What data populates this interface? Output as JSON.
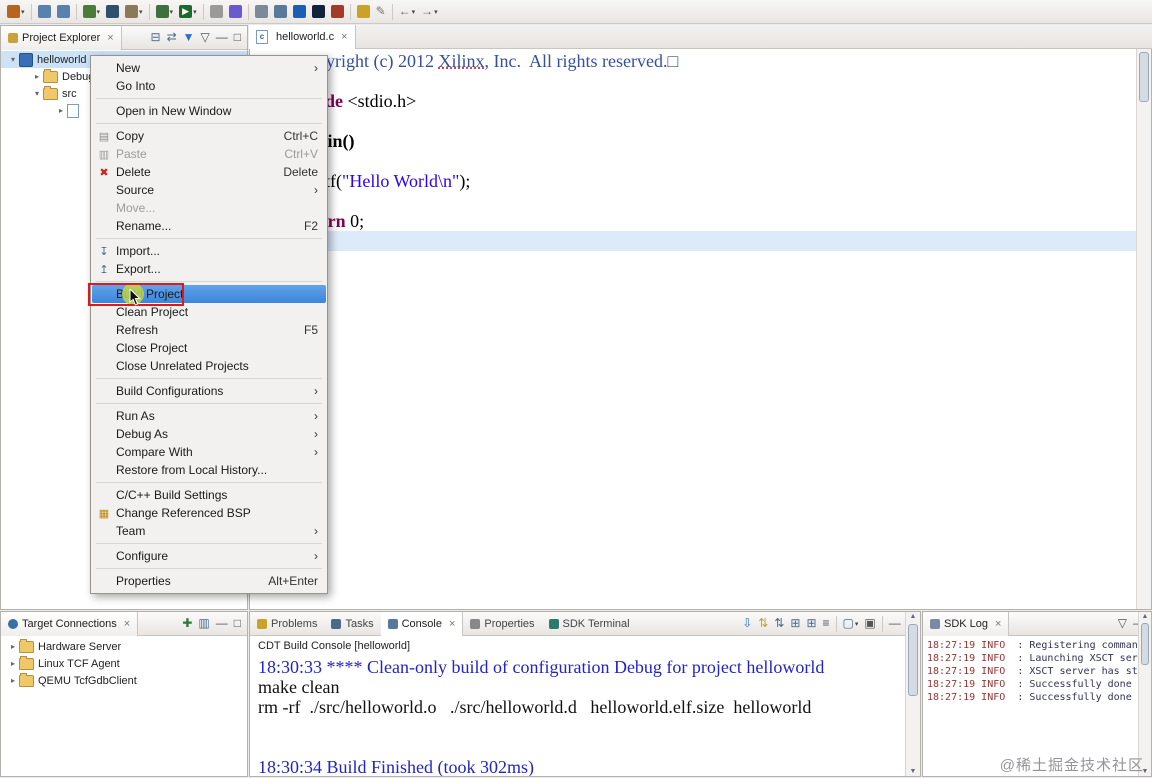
{
  "window": {
    "watermark": "@稀土掘金技术社区"
  },
  "ui": {
    "close_glyph": "×",
    "minimize_glyph": "—",
    "maximize_glyph": "□",
    "caret_glyph": "▾",
    "submenu_arrow": "›",
    "scroll_up_glyph": "▲",
    "scroll_down_glyph": "▼"
  },
  "toolbar": {
    "icons": [
      {
        "name": "new-wizard-icon",
        "color": "#b5651d",
        "caret": true
      },
      {
        "sep": true
      },
      {
        "name": "save-icon",
        "color": "#5a81ad"
      },
      {
        "name": "save-all-icon",
        "color": "#5a81ad"
      },
      {
        "sep": true
      },
      {
        "name": "program-fpga-icon",
        "color": "#4a7d3a",
        "caret": true
      },
      {
        "name": "launch-shell-icon",
        "color": "#2f4f6f"
      },
      {
        "name": "build-icon",
        "color": "#8a7a5a",
        "caret": true
      },
      {
        "sep": true
      },
      {
        "name": "debug-icon",
        "color": "#3f6f3f",
        "caret": true
      },
      {
        "name": "run-icon",
        "color": "#1c6b2a",
        "glyph": "▶",
        "caret": true
      },
      {
        "sep": true
      },
      {
        "name": "cut-icon",
        "color": "#9a9a9a"
      },
      {
        "name": "profile-icon",
        "color": "#6a5acd"
      },
      {
        "sep": true
      },
      {
        "name": "window-layout-icon",
        "color": "#7a8a9a"
      },
      {
        "name": "table-icon",
        "color": "#5a7a9a"
      },
      {
        "name": "vivado-icon",
        "color": "#1a5fb4"
      },
      {
        "name": "xsct-console-icon",
        "color": "#13233b"
      },
      {
        "name": "terminal-icon",
        "color": "#a33a2a"
      },
      {
        "sep": true
      },
      {
        "name": "key-icon",
        "color": "#c9a227"
      },
      {
        "name": "pencil-icon",
        "glyph": "✎",
        "gcolor": "#777777"
      },
      {
        "sep": true
      },
      {
        "name": "back-icon",
        "glyph": "←",
        "gcolor": "#666666",
        "caret": true
      },
      {
        "name": "forward-icon",
        "glyph": "→",
        "gcolor": "#666666",
        "caret": true
      }
    ]
  },
  "project_explorer": {
    "tab_label": "Project Explorer",
    "toolbar_icons": [
      {
        "name": "collapse-all-icon",
        "glyph": "⊟",
        "gcolor": "#4a6b8a"
      },
      {
        "name": "link-with-editor-icon",
        "glyph": "⇄",
        "gcolor": "#4a6b8a"
      },
      {
        "name": "filter-icon",
        "glyph": "▼",
        "gcolor": "#2a6fc9"
      },
      {
        "name": "view-menu-icon",
        "glyph": "▽",
        "gcolor": "#555555"
      },
      {
        "name": "minimize-icon",
        "glyph": "—",
        "gcolor": "#555555"
      },
      {
        "name": "maximize-icon",
        "glyph": "□",
        "gcolor": "#555555"
      }
    ],
    "tree": [
      {
        "label": "helloworld",
        "level": 0,
        "chev": "▾",
        "icon": "project",
        "selected": true
      },
      {
        "label": "Debug",
        "level": 1,
        "chev": "▸",
        "icon": "folder"
      },
      {
        "label": "src",
        "level": 1,
        "chev": "▾",
        "icon": "folder"
      },
      {
        "label": "",
        "level": 2,
        "chev": "▸",
        "icon": "cfile"
      }
    ]
  },
  "editor": {
    "tab_label": "helloworld.c",
    "file_icon_letter": "c",
    "lines": [
      {
        "parts": [
          {
            "t": " * Copyright (c) 2012 ",
            "c": "cmt"
          },
          {
            "t": "Xilinx",
            "c": "cmt ul"
          },
          {
            "t": ", Inc.  All rights reserved.□",
            "c": "cmt"
          }
        ]
      },
      {
        "parts": []
      },
      {
        "parts": [
          {
            "t": "#include",
            "c": "kw"
          },
          {
            "t": " ",
            "c": "plain"
          },
          {
            "t": "<stdio.h>",
            "c": "plain"
          }
        ]
      },
      {
        "parts": []
      },
      {
        "parts": [
          {
            "t": "int",
            "c": "kw"
          },
          {
            "t": " ",
            "c": "plain"
          },
          {
            "t": "main()",
            "c": "fn"
          }
        ]
      },
      {
        "parts": [
          {
            "t": "{",
            "c": "plain"
          }
        ]
      },
      {
        "parts": [
          {
            "t": "    printf(",
            "c": "plain"
          },
          {
            "t": "\"Hello World\\n\"",
            "c": "str"
          },
          {
            "t": ");",
            "c": "plain"
          }
        ]
      },
      {
        "parts": []
      },
      {
        "parts": [
          {
            "t": "    ",
            "c": "plain"
          },
          {
            "t": "return",
            "c": "kw"
          },
          {
            "t": " 0;",
            "c": "plain"
          }
        ]
      },
      {
        "parts": [
          {
            "t": "}",
            "c": "plain"
          }
        ],
        "highlight": true
      }
    ]
  },
  "context_menu": {
    "icon_glyphs": {
      "copy": {
        "g": "▤",
        "c": "#8a8a8a"
      },
      "paste": {
        "g": "▥",
        "c": "#9a9a9a"
      },
      "delete": {
        "g": "✖",
        "c": "#cc2222"
      },
      "import": {
        "g": "↧",
        "c": "#4a6b8a"
      },
      "export": {
        "g": "↥",
        "c": "#4a6b8a"
      },
      "bsp": {
        "g": "▦",
        "c": "#b8860b"
      }
    },
    "items": [
      {
        "label": "New",
        "submenu": true
      },
      {
        "label": "Go Into"
      },
      {
        "sep": true
      },
      {
        "label": "Open in New Window"
      },
      {
        "sep": true
      },
      {
        "label": "Copy",
        "shortcut": "Ctrl+C",
        "icon": "copy"
      },
      {
        "label": "Paste",
        "shortcut": "Ctrl+V",
        "icon": "paste",
        "disabled": true
      },
      {
        "label": "Delete",
        "shortcut": "Delete",
        "icon": "delete"
      },
      {
        "label": "Source",
        "submenu": true
      },
      {
        "label": "Move...",
        "disabled": true
      },
      {
        "label": "Rename...",
        "shortcut": "F2"
      },
      {
        "sep": true
      },
      {
        "label": "Import...",
        "icon": "import"
      },
      {
        "label": "Export...",
        "icon": "export"
      },
      {
        "sep": true
      },
      {
        "label": "Build Project",
        "selected": true
      },
      {
        "label": "Clean Project"
      },
      {
        "label": "Refresh",
        "shortcut": "F5"
      },
      {
        "label": "Close Project"
      },
      {
        "label": "Close Unrelated Projects"
      },
      {
        "sep": true
      },
      {
        "label": "Build Configurations",
        "submenu": true
      },
      {
        "sep": true
      },
      {
        "label": "Run As",
        "submenu": true
      },
      {
        "label": "Debug As",
        "submenu": true
      },
      {
        "label": "Compare With",
        "submenu": true
      },
      {
        "label": "Restore from Local History..."
      },
      {
        "sep": true
      },
      {
        "label": "C/C++ Build Settings"
      },
      {
        "label": "Change Referenced BSP",
        "icon": "bsp"
      },
      {
        "label": "Team",
        "submenu": true
      },
      {
        "sep": true
      },
      {
        "label": "Configure",
        "submenu": true
      },
      {
        "sep": true
      },
      {
        "label": "Properties",
        "shortcut": "Alt+Enter"
      }
    ]
  },
  "target_connections": {
    "tab_label": "Target Connections",
    "toolbar_icons": [
      {
        "name": "new-target-connection-icon",
        "glyph": "✚",
        "gcolor": "#2a7a3a"
      },
      {
        "name": "columns-icon",
        "glyph": "▥",
        "gcolor": "#4a6b8a"
      },
      {
        "name": "minimize-icon",
        "glyph": "—",
        "gcolor": "#555555"
      },
      {
        "name": "maximize-icon",
        "glyph": "□",
        "gcolor": "#555555"
      }
    ],
    "tree": [
      {
        "label": "Hardware Server",
        "chev": "▸",
        "icon": "folder"
      },
      {
        "label": "Linux TCF Agent",
        "chev": "▸",
        "icon": "folder"
      },
      {
        "label": "QEMU TcfGdbClient",
        "chev": "▸",
        "icon": "folder"
      }
    ]
  },
  "bottom_tabs": [
    {
      "label": "Problems",
      "color": "#c9a227"
    },
    {
      "label": "Tasks",
      "color": "#4a6b8a"
    },
    {
      "label": "Console",
      "color": "#55779a",
      "active": true
    },
    {
      "label": "Properties",
      "color": "#888888"
    },
    {
      "label": "SDK Terminal",
      "color": "#2a7a6a"
    }
  ],
  "console": {
    "header": "CDT Build Console [helloworld]",
    "toolbar_icons": [
      {
        "name": "scroll-to-end-icon",
        "glyph": "⇩",
        "gcolor": "#2a6fc9"
      },
      {
        "name": "show-on-stdout-icon",
        "glyph": "⇅",
        "gcolor": "#c9a227"
      },
      {
        "name": "show-on-stderr-icon",
        "glyph": "⇅",
        "gcolor": "#4a6b8a"
      },
      {
        "name": "open-console-icon",
        "glyph": "⊞",
        "gcolor": "#4a6b8a"
      },
      {
        "name": "clear-console-icon",
        "glyph": "⊞",
        "gcolor": "#4a6b8a"
      },
      {
        "name": "word-wrap-icon",
        "glyph": "≡",
        "gcolor": "#555555"
      },
      {
        "sep": true
      },
      {
        "name": "display-console-icon",
        "glyph": "▢",
        "gcolor": "#4a6b8a",
        "caret": true
      },
      {
        "name": "pin-console-icon",
        "glyph": "▣",
        "gcolor": "#555555"
      },
      {
        "sep": true
      },
      {
        "name": "minimize-icon",
        "glyph": "—",
        "gcolor": "#555555"
      },
      {
        "name": "maximize-icon",
        "glyph": "□",
        "gcolor": "#555555"
      }
    ],
    "lines": [
      {
        "text": "18:30:33 **** Clean-only build of configuration Debug for project helloworld",
        "cls": "c-blue"
      },
      {
        "text": "make clean",
        "cls": "c-black"
      },
      {
        "text": "rm -rf  ./src/helloworld.o   ./src/helloworld.d   helloworld.elf.size  helloworld",
        "cls": "c-black"
      },
      {
        "text": "",
        "cls": "c-black"
      },
      {
        "text": "",
        "cls": "c-black"
      },
      {
        "text": "18:30:34 Build Finished (took 302ms)",
        "cls": "c-blue"
      }
    ]
  },
  "sdk_log": {
    "tab_label": "SDK Log",
    "toolbar_icons": [
      {
        "name": "view-menu-icon",
        "glyph": "▽",
        "gcolor": "#555555"
      },
      {
        "name": "minimize-icon",
        "glyph": "—",
        "gcolor": "#555555"
      }
    ],
    "lines": [
      {
        "prefix": "18:27:19 INFO",
        "msg": "  : Registering command"
      },
      {
        "prefix": "18:27:19 INFO",
        "msg": "  : Launching XSCT serv"
      },
      {
        "prefix": "18:27:19 INFO",
        "msg": "  : XSCT server has star"
      },
      {
        "prefix": "18:27:19 INFO",
        "msg": "  : Successfully done"
      },
      {
        "prefix": "18:27:19 INFO",
        "msg": "  : Successfully done"
      }
    ]
  }
}
